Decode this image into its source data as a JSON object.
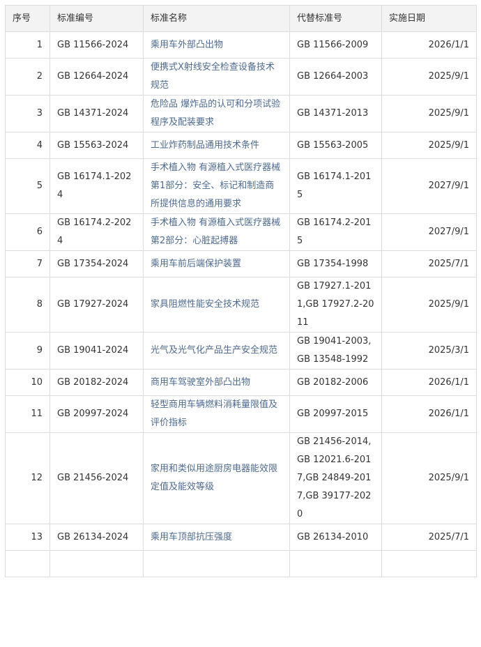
{
  "headers": {
    "no": "序号",
    "code": "标准编号",
    "name": "标准名称",
    "replaces": "代替标准号",
    "date": "实施日期"
  },
  "rows": [
    {
      "no": "1",
      "code": "GB 11566-2024",
      "name": "乘用车外部凸出物",
      "replaces": "GB 11566-2009",
      "date": "2026/1/1"
    },
    {
      "no": "2",
      "code": "GB 12664-2024",
      "name": "便携式X射线安全检查设备技术规范",
      "replaces": "GB 12664-2003",
      "date": "2025/9/1"
    },
    {
      "no": "3",
      "code": "GB 14371-2024",
      "name": "危险品 爆炸品的认可和分项试验程序及配装要求",
      "replaces": "GB 14371-2013",
      "date": "2025/9/1"
    },
    {
      "no": "4",
      "code": "GB 15563-2024",
      "name": "工业炸药制品通用技术条件",
      "replaces": "GB 15563-2005",
      "date": "2025/9/1"
    },
    {
      "no": "5",
      "code": "GB 16174.1-2024",
      "name": "手术植入物 有源植入式医疗器械 第1部分：安全、标记和制造商所提供信息的通用要求",
      "replaces": "GB 16174.1-2015",
      "date": "2027/9/1"
    },
    {
      "no": "6",
      "code": "GB 16174.2-2024",
      "name": "手术植入物 有源植入式医疗器械 第2部分：心脏起搏器",
      "replaces": "GB 16174.2-2015",
      "date": "2027/9/1"
    },
    {
      "no": "7",
      "code": "GB 17354-2024",
      "name": "乘用车前后端保护装置",
      "replaces": "GB 17354-1998",
      "date": "2025/7/1"
    },
    {
      "no": "8",
      "code": "GB 17927-2024",
      "name": "家具阻燃性能安全技术规范",
      "replaces": "GB 17927.1-2011,GB 17927.2-2011",
      "date": "2025/9/1"
    },
    {
      "no": "9",
      "code": "GB 19041-2024",
      "name": "光气及光气化产品生产安全规范",
      "replaces": "GB 19041-2003,GB 13548-1992",
      "date": "2025/3/1"
    },
    {
      "no": "10",
      "code": "GB 20182-2024",
      "name": "商用车驾驶室外部凸出物",
      "replaces": "GB 20182-2006",
      "date": "2026/1/1"
    },
    {
      "no": "11",
      "code": "GB 20997-2024",
      "name": "轻型商用车辆燃料消耗量限值及评价指标",
      "replaces": "GB 20997-2015",
      "date": "2026/1/1"
    },
    {
      "no": "12",
      "code": "GB 21456-2024",
      "name": "家用和类似用途厨房电器能效限定值及能效等级",
      "replaces": "GB 21456-2014,GB 12021.6-2017,GB 24849-2017,GB 39177-2020",
      "date": "2025/9/1"
    },
    {
      "no": "13",
      "code": "GB 26134-2024",
      "name": "乘用车顶部抗压强度",
      "replaces": "GB 26134-2010",
      "date": "2025/7/1"
    },
    {
      "no": "",
      "code": "",
      "name": "",
      "replaces": "",
      "date": ""
    }
  ]
}
